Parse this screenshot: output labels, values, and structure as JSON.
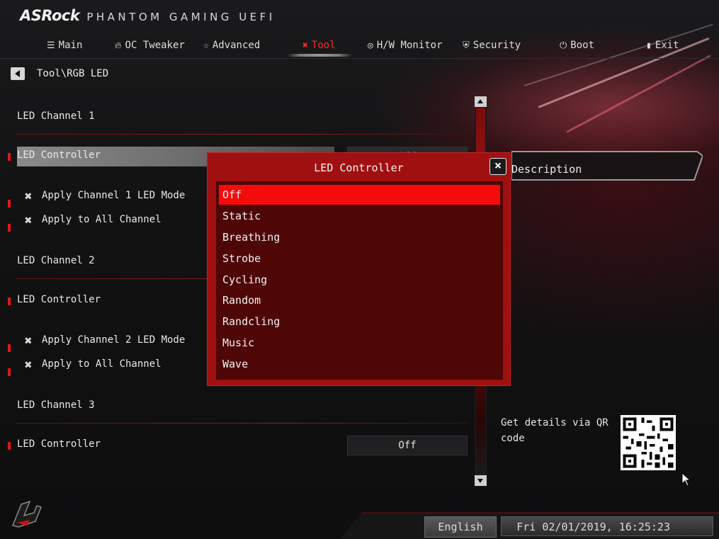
{
  "brand": {
    "logo": "ASRock",
    "subtitle": "PHANTOM GAMING UEFI"
  },
  "tabs": [
    {
      "label": "Main",
      "icon": "list-icon",
      "active": false
    },
    {
      "label": "OC Tweaker",
      "icon": "flame-icon",
      "active": false
    },
    {
      "label": "Advanced",
      "icon": "star-icon",
      "active": false
    },
    {
      "label": "Tool",
      "icon": "tools-icon",
      "active": true
    },
    {
      "label": "H/W Monitor",
      "icon": "monitor-icon",
      "active": false
    },
    {
      "label": "Security",
      "icon": "shield-icon",
      "active": false
    },
    {
      "label": "Boot",
      "icon": "power-icon",
      "active": false
    },
    {
      "label": "Exit",
      "icon": "exit-icon",
      "active": false
    }
  ],
  "breadcrumb": "Tool\\RGB LED",
  "channels": [
    {
      "title": "LED Channel 1",
      "controller_label": "LED Controller",
      "controller_value": "Off",
      "apply_mode_label": "Apply Channel 1 LED Mode",
      "apply_all_label": "Apply to All Channel"
    },
    {
      "title": "LED Channel 2",
      "controller_label": "LED Controller",
      "apply_mode_label": "Apply Channel 2 LED Mode",
      "apply_all_label": "Apply to All Channel"
    },
    {
      "title": "LED Channel 3",
      "controller_label": "LED Controller",
      "controller_value": "Off"
    }
  ],
  "description": {
    "label": "Description"
  },
  "qr": {
    "text": "Get details via QR code"
  },
  "footer": {
    "language": "English",
    "datetime": "Fri 02/01/2019, 16:25:23"
  },
  "modal": {
    "title": "LED Controller",
    "close_label": "×",
    "options": [
      "Off",
      "Static",
      "Breathing",
      "Strobe",
      "Cycling",
      "Random",
      "Randcling",
      "Music",
      "Wave"
    ],
    "selected_index": 0
  },
  "colors": {
    "accent": "#f40c0c",
    "modal_bg": "#a01010",
    "list_bg": "#4f0606",
    "marker": "#e01818"
  }
}
